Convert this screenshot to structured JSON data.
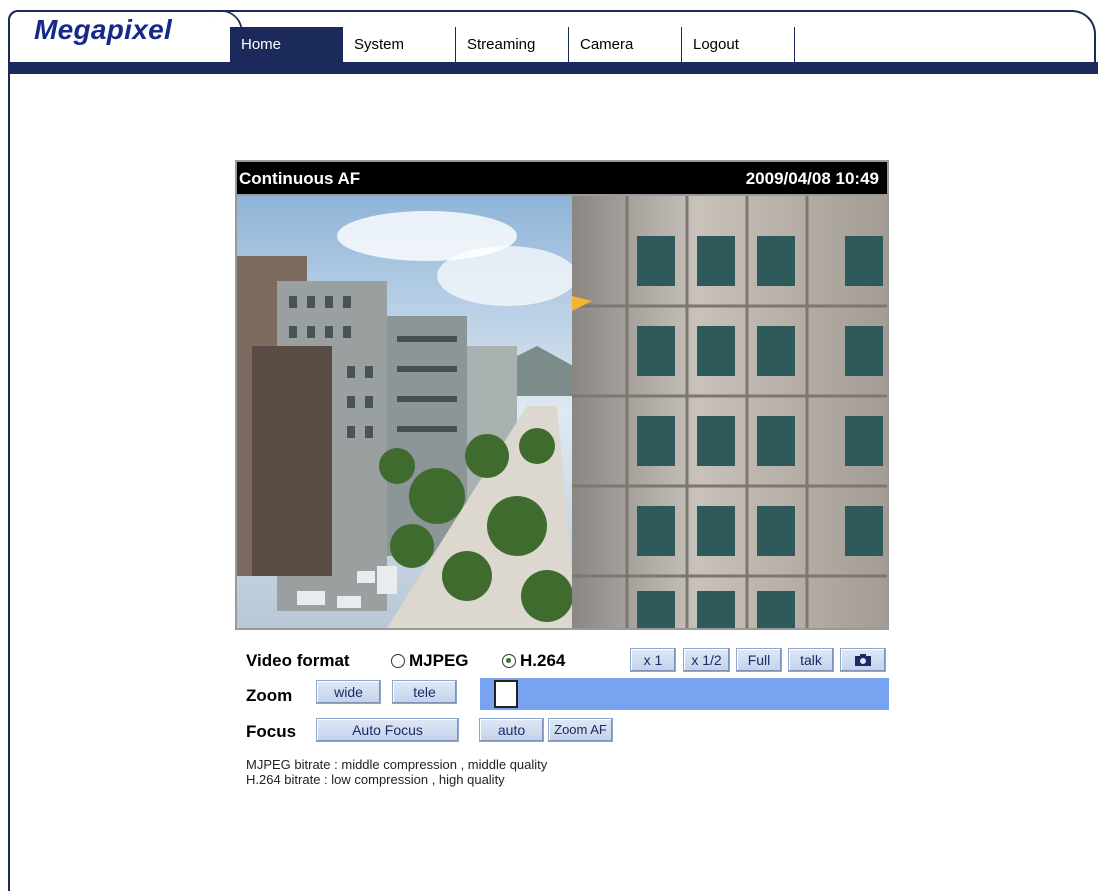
{
  "logo": "Megapixel",
  "nav": [
    {
      "label": "Home",
      "active": true
    },
    {
      "label": "System",
      "active": false
    },
    {
      "label": "Streaming",
      "active": false
    },
    {
      "label": "Camera",
      "active": false
    },
    {
      "label": "Logout",
      "active": false
    }
  ],
  "video": {
    "caption": "Continuous AF",
    "timestamp": "2009/04/08 10:49"
  },
  "controls": {
    "video_format_label": "Video format",
    "mjpeg_label": "MJPEG",
    "h264_label": "H.264",
    "selected_format": "H.264",
    "buttons": {
      "x1": "x 1",
      "x12": "x 1/2",
      "full": "Full",
      "talk": "talk",
      "snapshot_icon": "camera-icon"
    },
    "zoom_label": "Zoom",
    "wide_label": "wide",
    "tele_label": "tele",
    "zoom_level": 0.02,
    "focus_label": "Focus",
    "auto_focus_label": "Auto Focus",
    "auto_label": "auto",
    "zoom_af_label": "Zoom AF"
  },
  "status": {
    "mjpeg": "MJPEG bitrate : middle compression , middle quality",
    "h264": "H.264 bitrate : low compression , high quality"
  },
  "colors": {
    "brand": "#16288a",
    "nav_bar": "#1b2a5a",
    "slider": "#77a3f0"
  }
}
